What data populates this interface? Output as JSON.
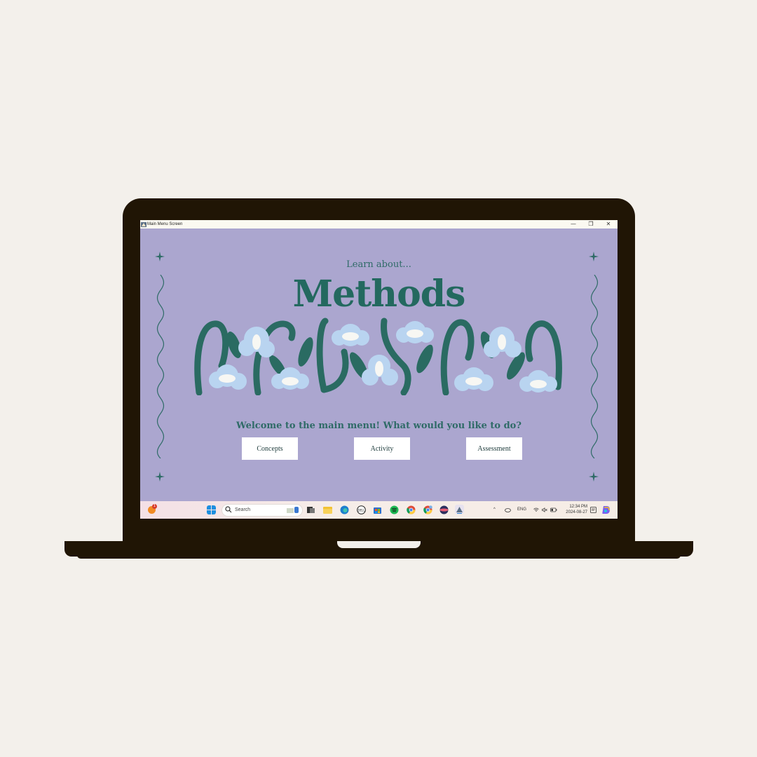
{
  "window": {
    "title": "Main Menu Screen",
    "minimize_glyph": "—",
    "restore_glyph": "❐",
    "close_glyph": "✕"
  },
  "app": {
    "subtitle": "Learn about...",
    "heading": "Methods",
    "welcome": "Welcome to the main menu! What would you like to do?",
    "buttons": {
      "concepts": "Concepts",
      "activity": "Activity",
      "assessment": "Assessment"
    }
  },
  "taskbar": {
    "search_placeholder": "Search",
    "notification_count": "1",
    "language": "ENG",
    "time": "12:34 PM",
    "date": "2024-08-27",
    "icons": [
      "weather-icon",
      "windows-start-icon",
      "search-icon",
      "task-view-icon",
      "file-explorer-icon",
      "edge-icon",
      "dell-icon",
      "store-icon",
      "spotify-icon",
      "chrome-icon",
      "chrome-profile-icon",
      "app-icon",
      "java-app-icon"
    ]
  },
  "colors": {
    "background": "#f3f0eb",
    "laptop": "#201505",
    "screen": "#aba6cf",
    "accent": "#23695f",
    "flower": "#b9d4f0",
    "flower_center": "#f7f7f3"
  }
}
